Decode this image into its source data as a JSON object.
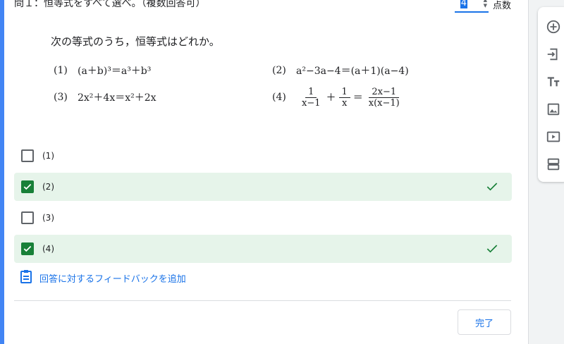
{
  "question": {
    "header": "問１：恒等式をすべて選べ。（複数回答可）",
    "points_value": "4",
    "points_label": "点数"
  },
  "problem": {
    "title": "次の等式のうち，恒等式はどれか。",
    "items": [
      {
        "num": "(1)",
        "expr": "(a＋b)³＝a³＋b³"
      },
      {
        "num": "(2)",
        "expr": "a²−3a−4＝(a＋1)(a−4)"
      },
      {
        "num": "(3)",
        "expr": "2x²＋4x＝x²＋2x"
      },
      {
        "num": "(4)",
        "frac1_num": "1",
        "frac1_den": "x−1",
        "plus": "＋",
        "frac2_num": "1",
        "frac2_den": "x",
        "eq": "＝",
        "frac3_num": "2x−1",
        "frac3_den": "x(x−1)"
      }
    ]
  },
  "options": [
    {
      "label": "(1)",
      "checked": false,
      "correct": false
    },
    {
      "label": "(2)",
      "checked": true,
      "correct": true
    },
    {
      "label": "(3)",
      "checked": false,
      "correct": false
    },
    {
      "label": "(4)",
      "checked": true,
      "correct": true
    }
  ],
  "feedback_link": "回答に対するフィードバックを追加",
  "done_label": "完了",
  "toolbar_icons": [
    "add-question-icon",
    "import-questions-icon",
    "add-title-icon",
    "add-image-icon",
    "add-video-icon",
    "add-section-icon"
  ],
  "colors": {
    "accent": "#1a73e8",
    "correct_bg": "#e6f4ea",
    "check_green": "#188038"
  }
}
